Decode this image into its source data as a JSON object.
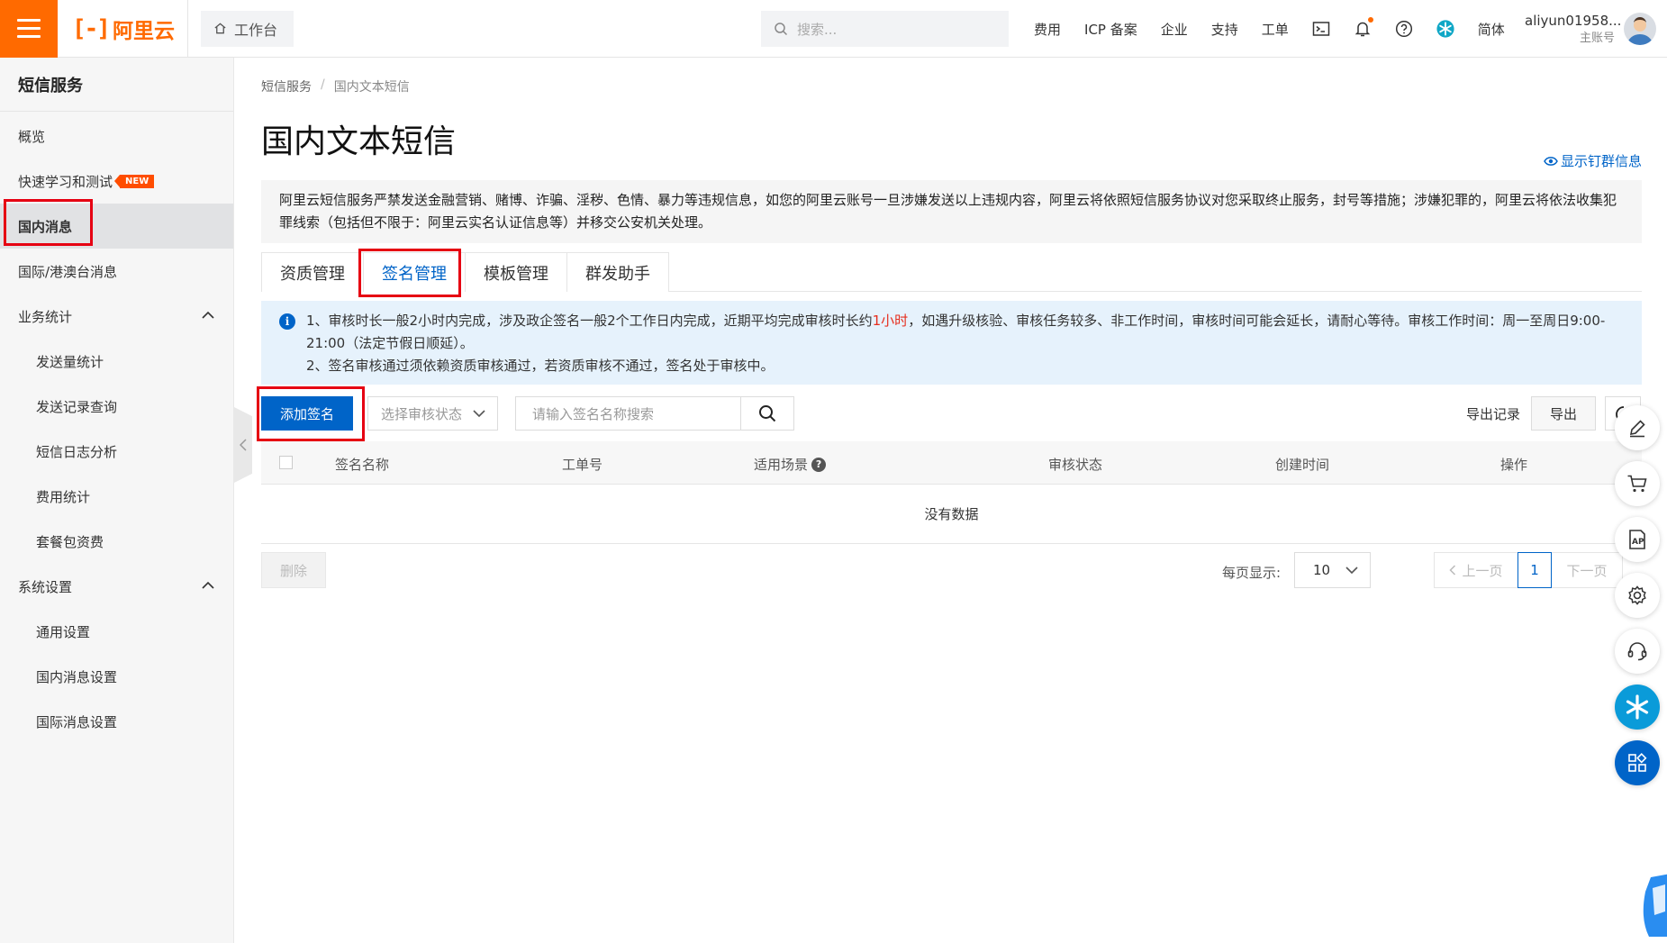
{
  "topbar": {
    "logo_text": "阿里云",
    "workbench_label": "工作台",
    "search_placeholder": "搜索...",
    "nav": [
      "费用",
      "ICP 备案",
      "企业",
      "支持",
      "工单"
    ],
    "lang": "简体",
    "user_name": "aliyun01958...",
    "user_role": "主账号",
    "accent_color": "#ff6a00"
  },
  "sidebar": {
    "title": "短信服务",
    "items": [
      {
        "label": "概览"
      },
      {
        "label": "快速学习和测试",
        "badge": "NEW"
      },
      {
        "label": "国内消息",
        "active": true
      },
      {
        "label": "国际/港澳台消息"
      },
      {
        "label": "业务统计",
        "group": true
      },
      {
        "label": "发送量统计",
        "sub": true
      },
      {
        "label": "发送记录查询",
        "sub": true
      },
      {
        "label": "短信日志分析",
        "sub": true
      },
      {
        "label": "费用统计",
        "sub": true
      },
      {
        "label": "套餐包资费",
        "sub": true
      },
      {
        "label": "系统设置",
        "group": true
      },
      {
        "label": "通用设置",
        "sub": true
      },
      {
        "label": "国内消息设置",
        "sub": true
      },
      {
        "label": "国际消息设置",
        "sub": true
      }
    ]
  },
  "main": {
    "breadcrumb": [
      "短信服务",
      "国内文本短信"
    ],
    "title": "国内文本短信",
    "show_group_link": "显示钉群信息",
    "warning": "阿里云短信服务严禁发送金融营销、赌博、诈骗、淫秽、色情、暴力等违规信息，如您的阿里云账号一旦涉嫌发送以上违规内容，阿里云将依照短信服务协议对您采取终止服务，封号等措施；涉嫌犯罪的，阿里云将依法收集犯罪线索（包括但不限于：阿里云实名认证信息等）并移交公安机关处理。",
    "tabs": [
      {
        "label": "资质管理"
      },
      {
        "label": "签名管理",
        "active": true
      },
      {
        "label": "模板管理"
      },
      {
        "label": "群发助手"
      }
    ],
    "notice": {
      "line1_pre": "1、审核时长一般2小时内完成，涉及政企签名一般2个工作日内完成，近期平均完成审核时长约",
      "line1_highlight": "1小时",
      "line1_post": "，如遇升级核验、审核任务较多、非工作时间，审核时间可能会延长，请耐心等待。审核工作时间：周一至周日9:00-21:00（法定节假日顺延）。",
      "line2": "2、签名审核通过须依赖资质审核通过，若资质审核不通过，签名处于审核中。"
    },
    "toolbar": {
      "add_button": "添加签名",
      "status_select_placeholder": "选择审核状态",
      "search_placeholder": "请输入签名名称搜索",
      "export_records": "导出记录",
      "export_button": "导出"
    },
    "table": {
      "columns": [
        "签名名称",
        "工单号",
        "适用场景",
        "审核状态",
        "创建时间",
        "操作"
      ],
      "empty_text": "没有数据"
    },
    "footer": {
      "delete_button": "删除",
      "per_page_label": "每页显示:",
      "per_page_value": "10",
      "prev": "上一页",
      "current_page": "1",
      "next": "下一页"
    }
  }
}
